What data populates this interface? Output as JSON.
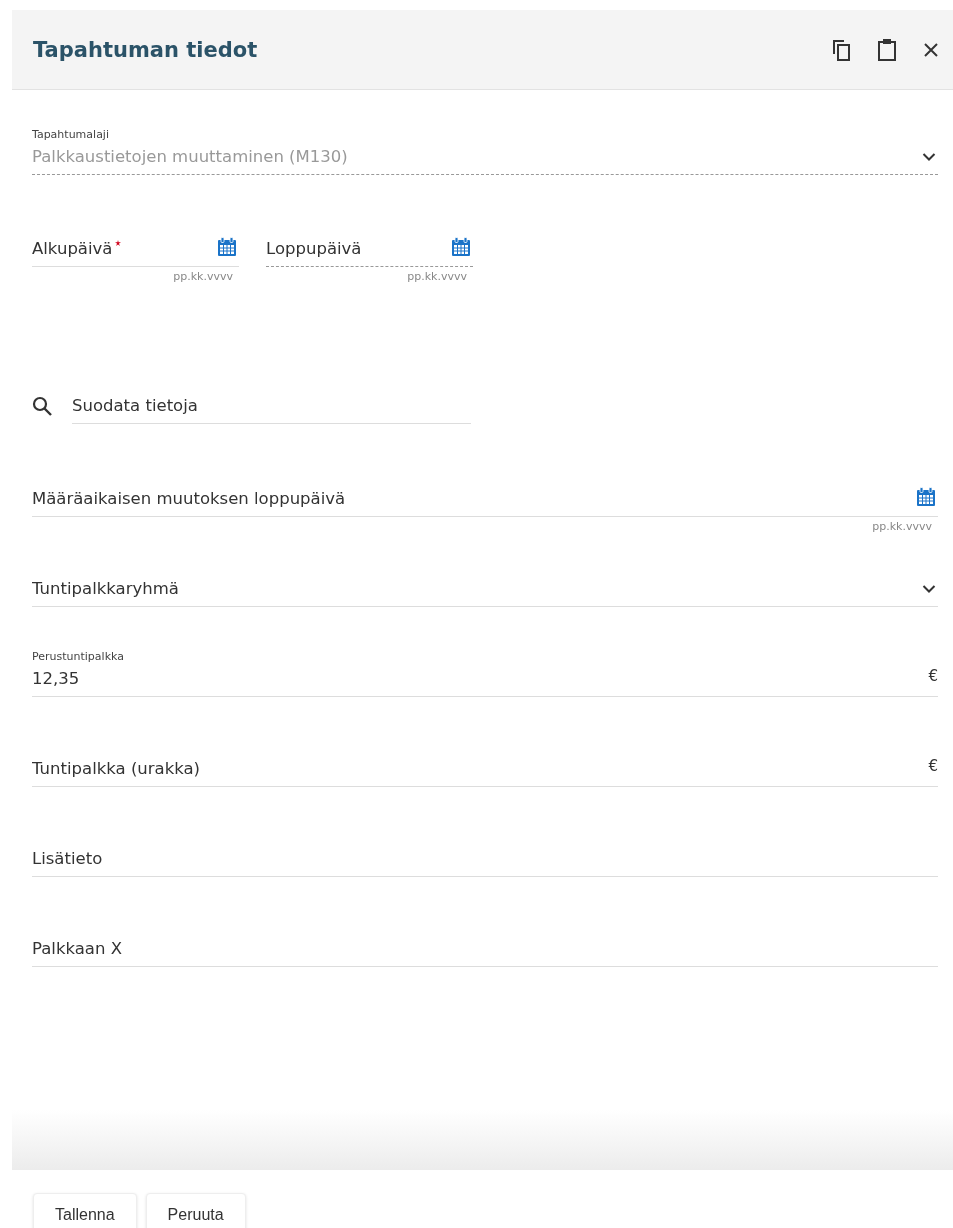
{
  "dialog": {
    "title": "Tapahtuman tiedot"
  },
  "event_type": {
    "label": "Tapahtumalaji",
    "value": "Palkkaustietojen muuttaminen (M130)",
    "disabled": true
  },
  "dates": [
    {
      "placeholder": "Alkupäivä",
      "required": true,
      "disabled": false,
      "hint": "pp.kk.vvvv"
    },
    {
      "placeholder": "Loppupäivä",
      "required": false,
      "disabled": true,
      "hint": "pp.kk.vvvv"
    }
  ],
  "filter": {
    "placeholder": "Suodata tietoja"
  },
  "fields": [
    {
      "kind": "date",
      "placeholder": "Määräaikaisen muutoksen loppupäivä",
      "hint": "pp.kk.vvvv"
    },
    {
      "kind": "select",
      "placeholder": "Tuntipalkkaryhmä"
    },
    {
      "kind": "currency",
      "label": "Perustuntipalkka",
      "value": "12,35",
      "unit": "€"
    },
    {
      "kind": "currency",
      "placeholder": "Tuntipalkka (urakka)",
      "unit": "€"
    },
    {
      "kind": "text",
      "placeholder": "Lisätieto"
    },
    {
      "kind": "text",
      "placeholder": "Palkkaan X"
    }
  ],
  "buttons": [
    "Tallenna",
    "Peruuta"
  ]
}
